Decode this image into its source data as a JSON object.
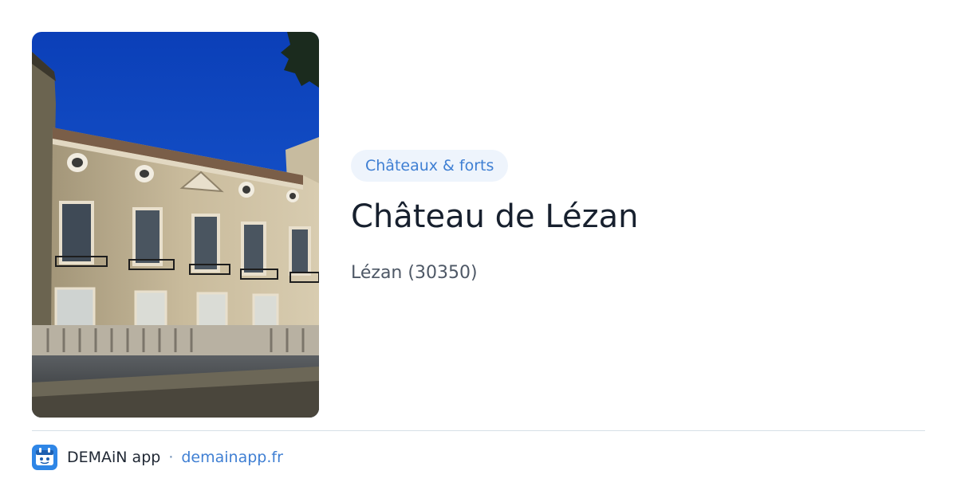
{
  "place": {
    "category": "Châteaux & forts",
    "title": "Château de Lézan",
    "location": "Lézan (30350)"
  },
  "footer": {
    "app_name": "DEMAiN app",
    "separator": "·",
    "url": "demainapp.fr",
    "logo_icon": "demain-app-logo-icon"
  },
  "colors": {
    "accent": "#3f7fd3",
    "pill_bg": "#eef4fc",
    "title": "#17202e",
    "subtitle": "#4e5866",
    "divider": "#d6e0e6"
  }
}
